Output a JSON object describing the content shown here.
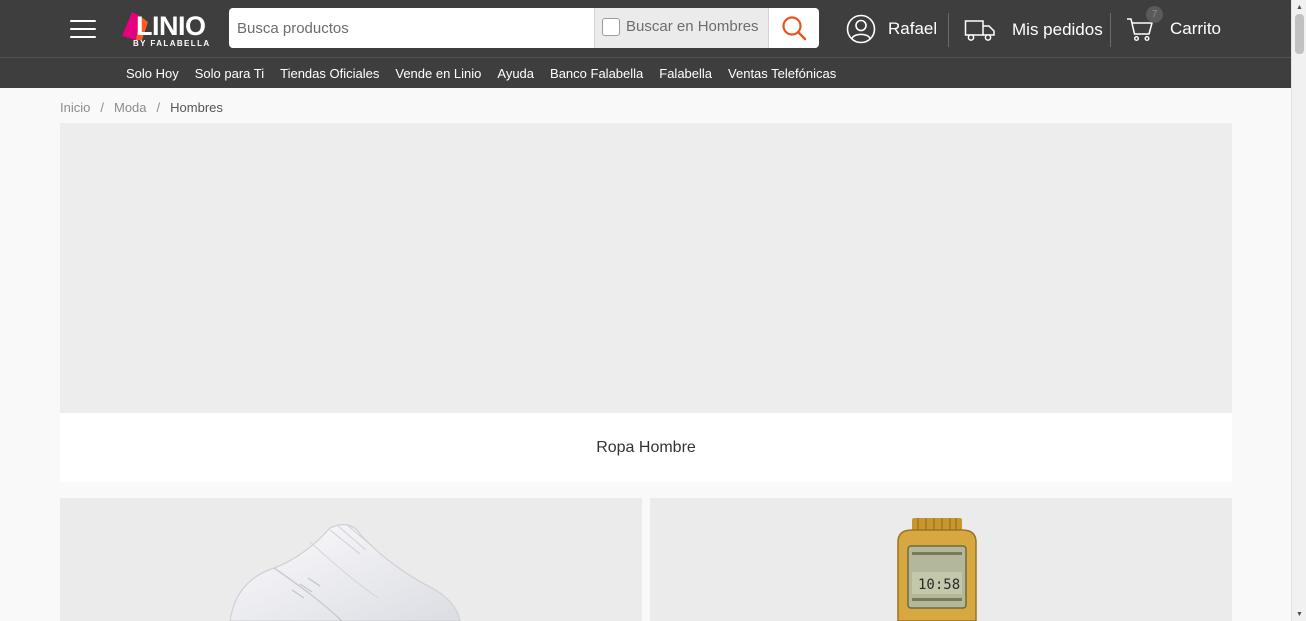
{
  "header": {
    "logo_text": "LINIO",
    "logo_sub": "BY FALABELLA",
    "search": {
      "placeholder": "Busca productos",
      "scope_label": "Buscar en Hombres"
    },
    "account_label": "Rafael",
    "orders_label": "Mis pedidos",
    "cart_label": "Carrito",
    "cart_count": "7"
  },
  "subnav": {
    "items": [
      {
        "label": "Solo Hoy"
      },
      {
        "label": "Solo para Ti"
      },
      {
        "label": "Tiendas Oficiales"
      },
      {
        "label": "Vende en Linio"
      },
      {
        "label": "Ayuda"
      },
      {
        "label": "Banco Falabella"
      },
      {
        "label": "Falabella"
      },
      {
        "label": "Ventas Telefónicas"
      }
    ]
  },
  "breadcrumb": {
    "items": [
      "Inicio",
      "Moda"
    ],
    "current": "Hombres"
  },
  "hero": {
    "caption": "Ropa Hombre"
  },
  "colors": {
    "header_bg": "#3e3e3e",
    "accent": "#e8531f",
    "brand_pink": "#e6007e"
  },
  "icons": [
    "menu-icon",
    "search-icon",
    "user-icon",
    "truck-icon",
    "cart-icon"
  ]
}
